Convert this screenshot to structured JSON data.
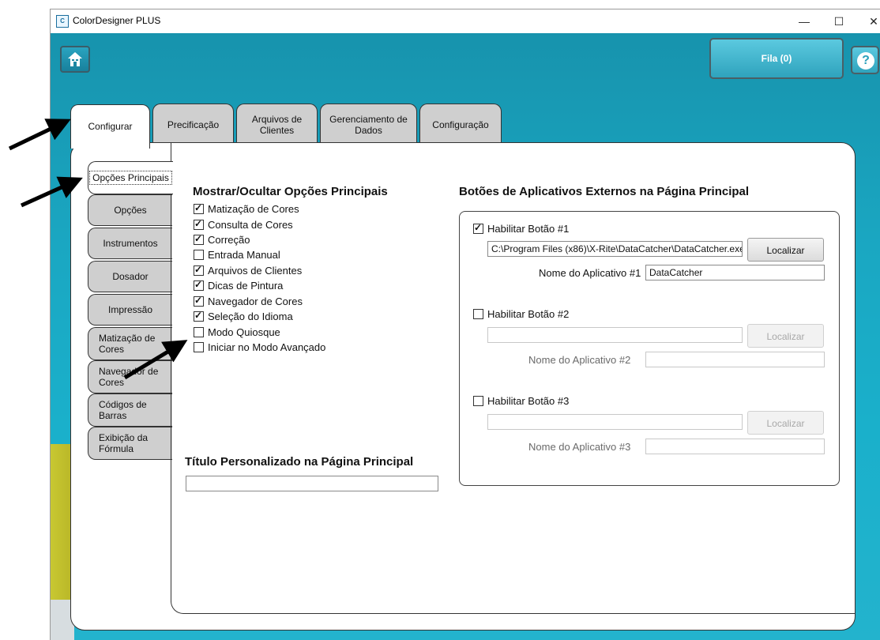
{
  "window": {
    "title": "ColorDesigner PLUS",
    "minimize": "—",
    "maximize": "☐",
    "close": "✕",
    "icon_label": "C"
  },
  "toolbar": {
    "queue_label": "Fila (0)",
    "help_label": "?"
  },
  "tabs": [
    {
      "label": "Configurar"
    },
    {
      "label": "Precificação"
    },
    {
      "label": "Arquivos de Clientes"
    },
    {
      "label": "Gerenciamento de Dados"
    },
    {
      "label": "Configuração"
    }
  ],
  "side_tabs": [
    {
      "label": "Opções Principais"
    },
    {
      "label": "Opções"
    },
    {
      "label": "Instrumentos"
    },
    {
      "label": "Dosador"
    },
    {
      "label": "Impressão"
    },
    {
      "label": "Matização de Cores"
    },
    {
      "label": "Navegador de Cores"
    },
    {
      "label": "Códigos de Barras"
    },
    {
      "label": "Exibição da Fórmula"
    }
  ],
  "main_options": {
    "heading": "Mostrar/Ocultar Opções Principais",
    "items": [
      {
        "label": "Matização de Cores",
        "checked": true
      },
      {
        "label": "Consulta de Cores",
        "checked": true
      },
      {
        "label": "Correção",
        "checked": true
      },
      {
        "label": "Entrada Manual",
        "checked": false
      },
      {
        "label": "Arquivos de Clientes",
        "checked": true
      },
      {
        "label": "Dicas de Pintura",
        "checked": true
      },
      {
        "label": "Navegador de Cores",
        "checked": true
      },
      {
        "label": "Seleção do Idioma",
        "checked": true
      },
      {
        "label": "Modo Quiosque",
        "checked": false
      },
      {
        "label": "Iniciar no Modo Avançado",
        "checked": false
      }
    ]
  },
  "custom_title": {
    "heading": "Título Personalizado na Página Principal",
    "value": ""
  },
  "external_apps": {
    "heading": "Botões de Aplicativos Externos na Página Principal",
    "buttons": [
      {
        "enable_label": "Habilitar Botão #1",
        "enabled": true,
        "path": "C:\\Program Files (x86)\\X-Rite\\DataCatcher\\DataCatcher.exe",
        "browse_label": "Localizar",
        "name_label": "Nome do Aplicativo #1",
        "name_value": "DataCatcher"
      },
      {
        "enable_label": "Habilitar Botão #2",
        "enabled": false,
        "path": "",
        "browse_label": "Localizar",
        "name_label": "Nome do Aplicativo #2",
        "name_value": ""
      },
      {
        "enable_label": "Habilitar Botão #3",
        "enabled": false,
        "path": "",
        "browse_label": "Localizar",
        "name_label": "Nome do Aplicativo #3",
        "name_value": ""
      }
    ]
  }
}
